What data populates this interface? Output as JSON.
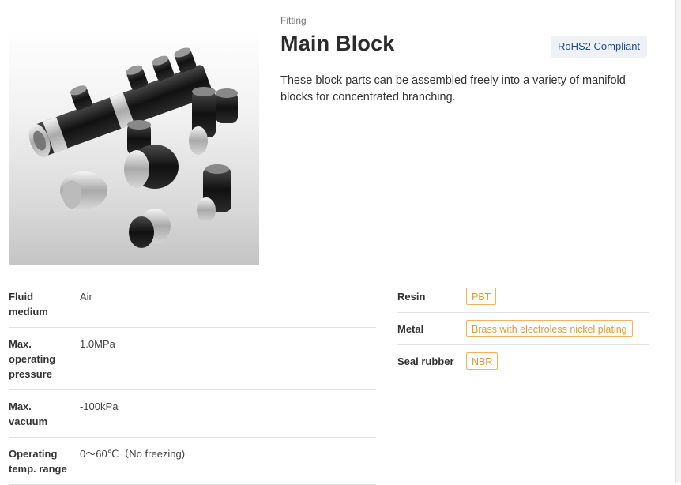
{
  "product": {
    "category": "Fitting",
    "title": "Main Block",
    "badge": "RoHS2 Compliant",
    "description": "These block parts can be assembled freely into a variety of manifold blocks for concentrated branching."
  },
  "specs": [
    {
      "label": "Fluid medium",
      "value": "Air"
    },
    {
      "label": "Max. operating pressure",
      "value": "1.0MPa"
    },
    {
      "label": "Max. vacuum",
      "value": "-100kPa"
    },
    {
      "label": "Operating temp. range",
      "value": "0～60℃（No freezing)"
    }
  ],
  "materials": [
    {
      "label": "Resin",
      "value": "PBT"
    },
    {
      "label": "Metal",
      "value": "Brass with electroless nickel plating"
    },
    {
      "label": "Seal rubber",
      "value": "NBR"
    }
  ],
  "colors": {
    "badge_text": "#1f4f86",
    "badge_bg": "#eef1f6",
    "tag_orange": "#e79a2b"
  }
}
